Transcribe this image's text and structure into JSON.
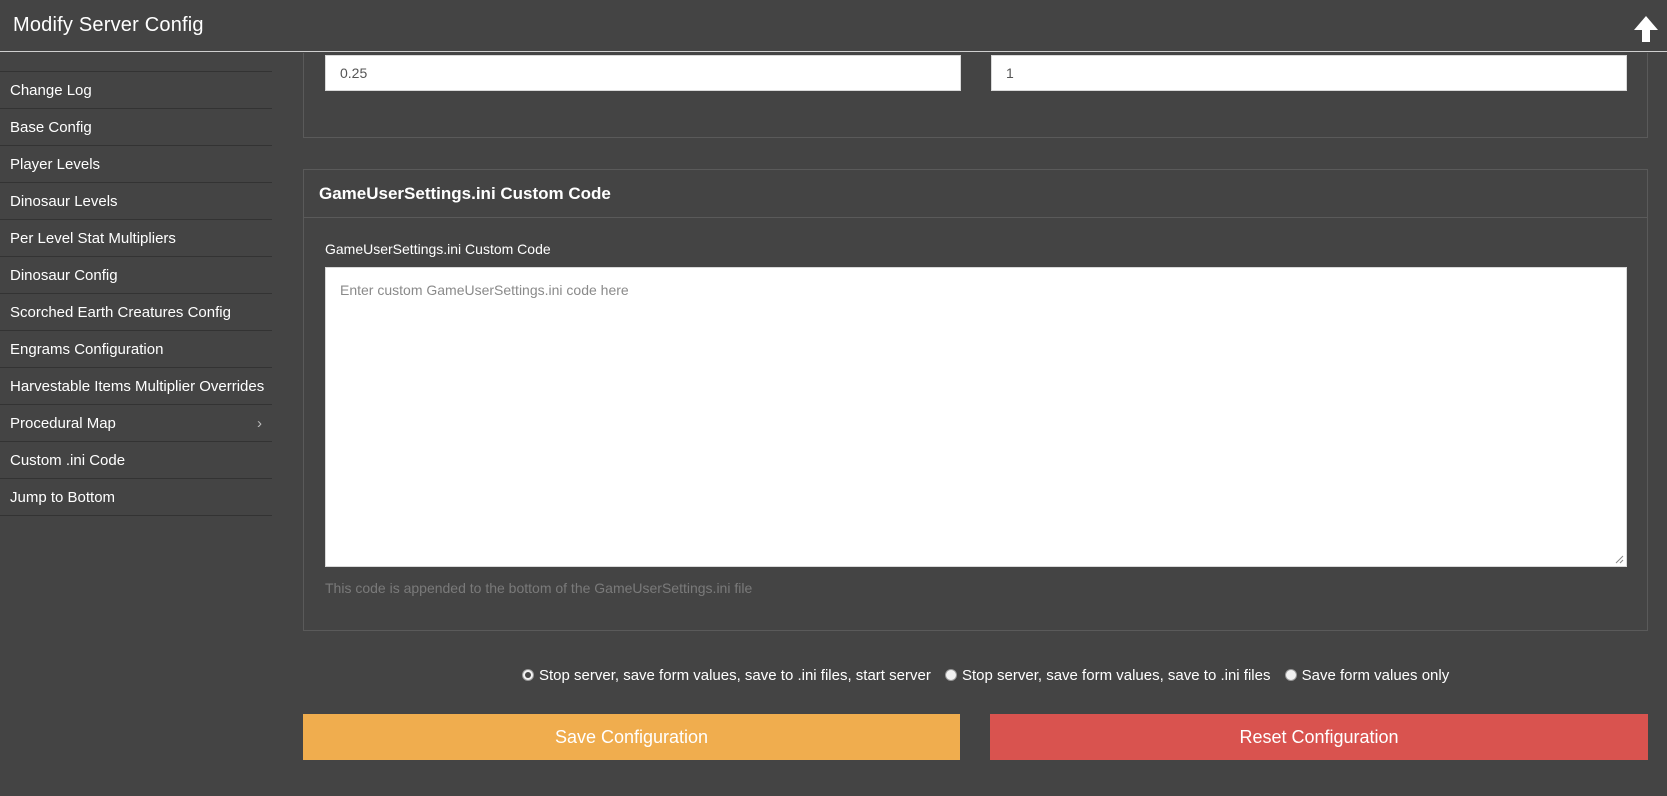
{
  "app": {
    "title": "Modify Server Config"
  },
  "sidebar": {
    "items": [
      {
        "label": "Change Log"
      },
      {
        "label": "Base Config"
      },
      {
        "label": "Player Levels"
      },
      {
        "label": "Dinosaur Levels"
      },
      {
        "label": "Per Level Stat Multipliers"
      },
      {
        "label": "Dinosaur Config"
      },
      {
        "label": "Scorched Earth Creatures Config"
      },
      {
        "label": "Engrams Configuration"
      },
      {
        "label": "Harvestable Items Multiplier Overrides"
      },
      {
        "label": "Procedural Map",
        "chevron": "›"
      },
      {
        "label": "Custom .ini Code"
      },
      {
        "label": "Jump to Bottom"
      }
    ]
  },
  "top_fields": {
    "left_value": "0.25",
    "right_value": "1"
  },
  "custom_code": {
    "panel_title": "GameUserSettings.ini Custom Code",
    "field_label": "GameUserSettings.ini Custom Code",
    "placeholder": "Enter custom GameUserSettings.ini code here",
    "help_text": "This code is appended to the bottom of the GameUserSettings.ini file"
  },
  "save_options": {
    "options": [
      {
        "label": "Stop server, save form values, save to .ini files, start server",
        "checked": true
      },
      {
        "label": "Stop server, save form values, save to .ini files",
        "checked": false
      },
      {
        "label": "Save form values only",
        "checked": false
      }
    ]
  },
  "buttons": {
    "save": "Save Configuration",
    "reset": "Reset Configuration"
  },
  "colors": {
    "background": "#444444",
    "save_button": "#f0ad4e",
    "reset_button": "#d9534f"
  },
  "icons": {
    "top_right": "arrow-up-icon"
  }
}
